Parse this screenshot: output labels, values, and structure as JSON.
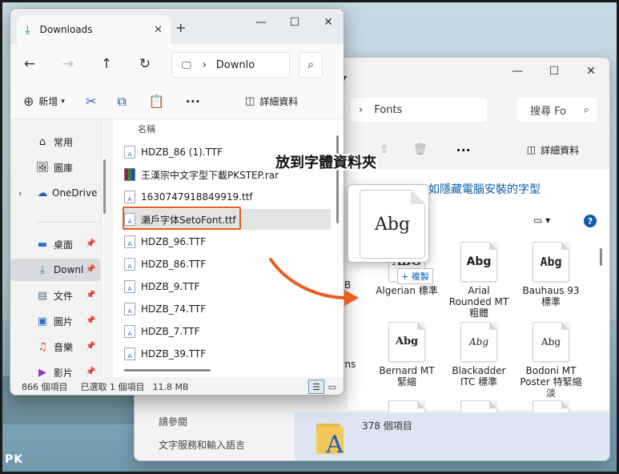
{
  "callout": "放到字體資料夾",
  "front": {
    "tab_title": "Downloads",
    "new_tab": "+",
    "address": "Downlo",
    "toolbar": {
      "new_label": "新增",
      "details_label": "詳細資料"
    },
    "nav": [
      {
        "label": "常用",
        "icon": "home-icon"
      },
      {
        "label": "圖庫",
        "icon": "gallery-icon"
      },
      {
        "label": "OneDrive",
        "icon": "cloud-icon"
      },
      {
        "label": "桌面",
        "icon": "desktop-icon"
      },
      {
        "label": "Downl",
        "icon": "download-icon"
      },
      {
        "label": "文件",
        "icon": "document-icon"
      },
      {
        "label": "圖片",
        "icon": "picture-icon"
      },
      {
        "label": "音樂",
        "icon": "music-icon"
      },
      {
        "label": "影片",
        "icon": "video-icon"
      }
    ],
    "column_name": "名稱",
    "files": [
      "HDZB_86 (1).TTF",
      "王漢宗中文字型下載PKSTEP.rar",
      "1630747918849919.ttf",
      "瀨戶字体SetoFont.ttf",
      "HDZB_96.TTF",
      "HDZB_86.TTF",
      "HDZB_9.TTF",
      "HDZB_74.TTF",
      "HDZB_7.TTF",
      "HDZB_39.TTF"
    ],
    "status": {
      "count": "866 個項目",
      "selected": "已選取 1 個項目",
      "size": "11.8 MB"
    }
  },
  "back": {
    "address": "Fonts",
    "search_placeholder": "搜尋 Fo",
    "details_label": "詳細資料",
    "subtitle": "如隱藏電腦安裝的字型",
    "fonts_row1": [
      {
        "label": "Algerian 標準",
        "sample": "ABG"
      },
      {
        "label": "Arial Rounded MT 粗體",
        "sample": "Abg"
      },
      {
        "label": "Bauhaus 93 標準",
        "sample": "Abg"
      }
    ],
    "fonts_row2": [
      {
        "label": "Bernard MT 緊縮",
        "sample": "Abg"
      },
      {
        "label": "Blackadder ITC 標準",
        "sample": "Abg"
      },
      {
        "label": "Bodoni MT Poster 特緊縮 淡",
        "sample": "Abg"
      }
    ],
    "left_stub_1": "FB",
    "left_stub_2": "ans",
    "see_also": "請參閱",
    "see_also_link": "文字服務和輸入語言",
    "item_count": "378 個項目"
  },
  "drag": {
    "sample": "Abg",
    "copy_tip": "+ 複製"
  },
  "watermark": "PK"
}
